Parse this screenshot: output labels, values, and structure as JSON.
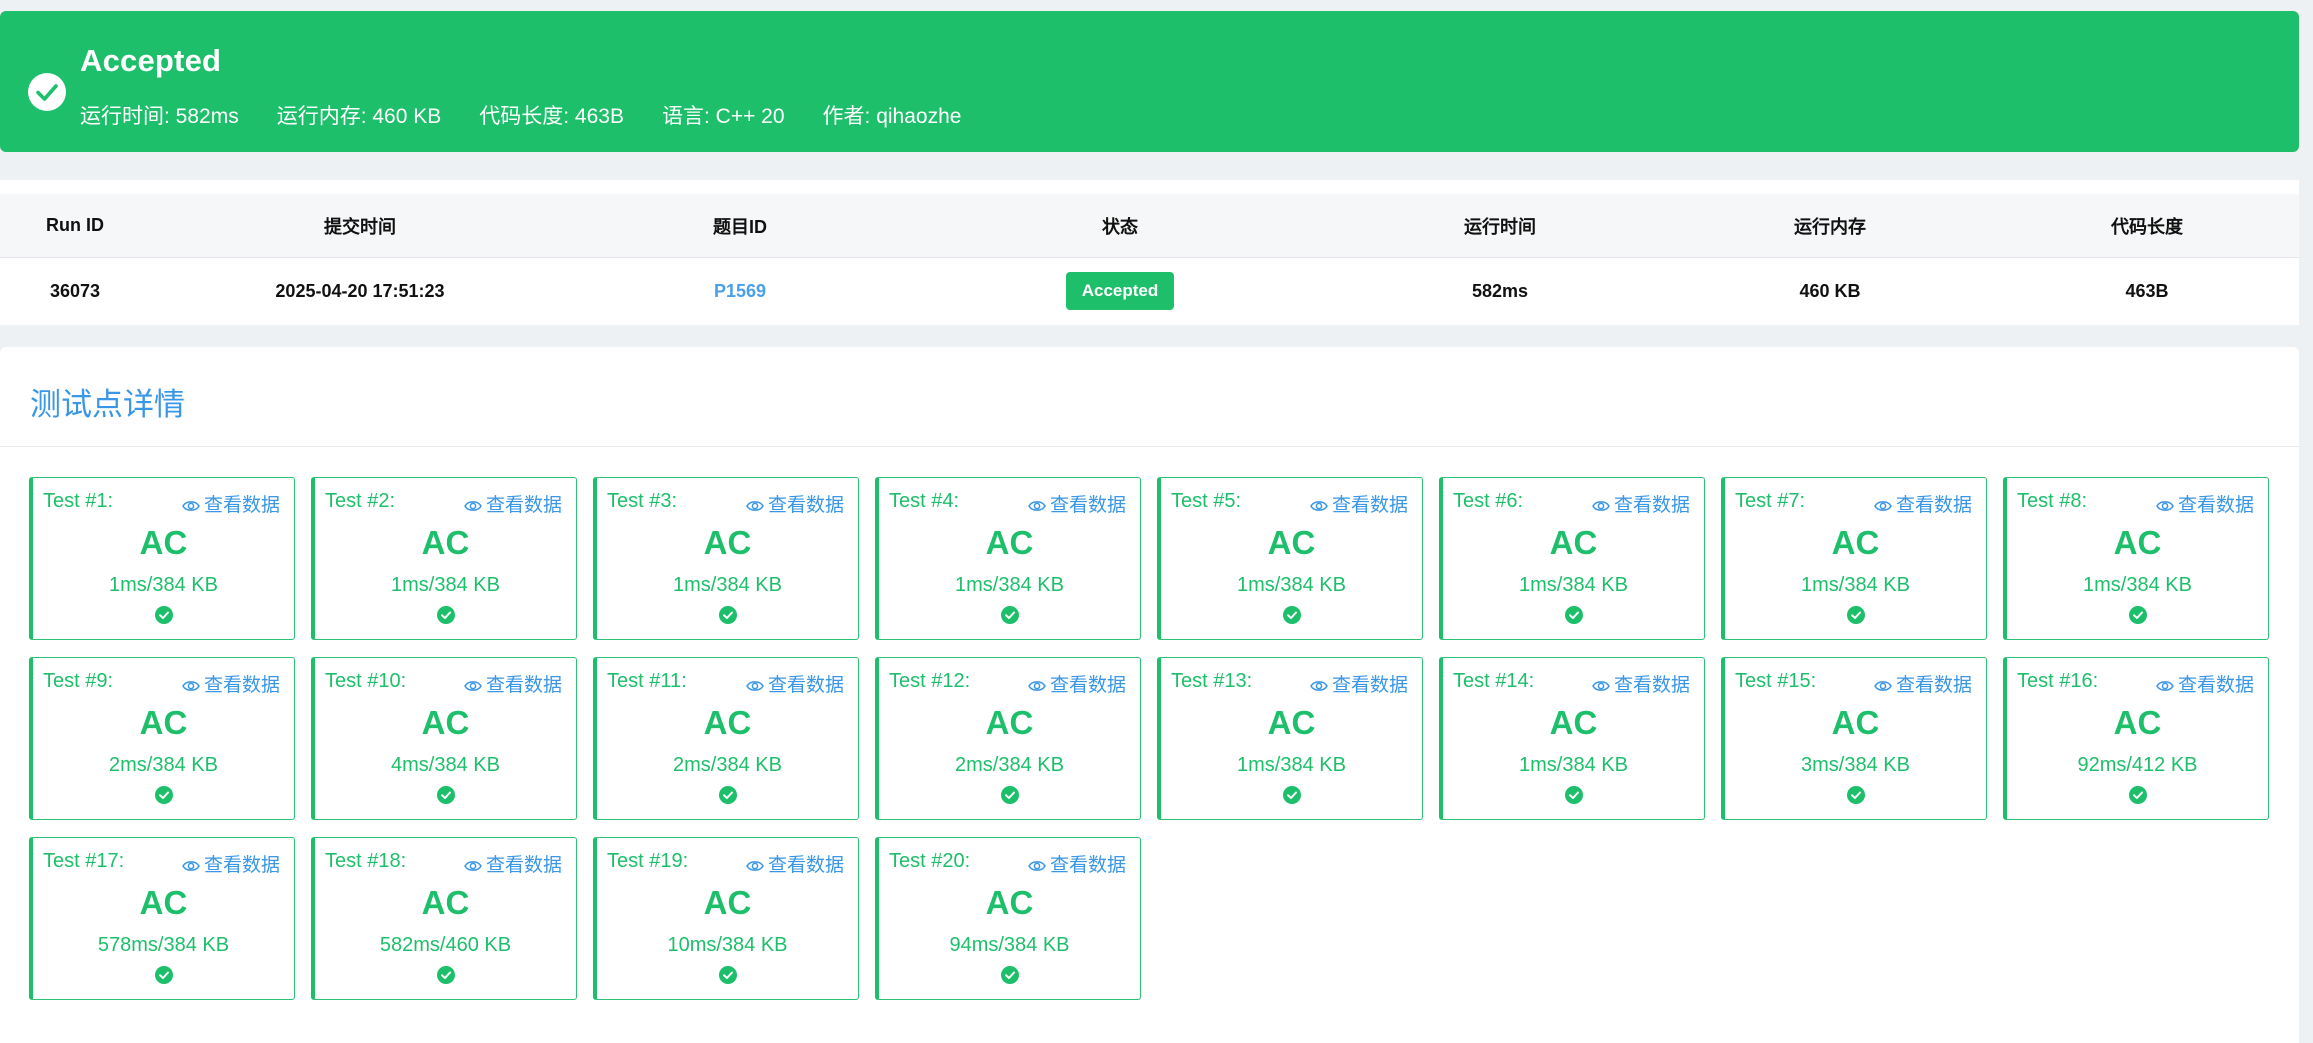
{
  "banner": {
    "status": "Accepted",
    "runtime": "运行时间: 582ms",
    "memory": "运行内存: 460 KB",
    "code_length": "代码长度: 463B",
    "language": "语言: C++ 20",
    "author": "作者: qihaozhe",
    "icon": "check-circle-icon",
    "color": "#1ebf6b"
  },
  "run_table": {
    "headers": [
      "Run ID",
      "提交时间",
      "题目ID",
      "状态",
      "运行时间",
      "运行内存",
      "代码长度"
    ],
    "row": {
      "run_id": "36073",
      "submit_time": "2025-04-20 17:51:23",
      "problem_id": "P1569",
      "status": "Accepted",
      "runtime": "582ms",
      "memory": "460 KB",
      "code_length": "463B"
    }
  },
  "tests_panel": {
    "title": "测试点详情",
    "view_label": "查看数据",
    "view_icon": "eye-icon",
    "tests": [
      {
        "name": "Test #1:",
        "verdict": "AC",
        "usage": "1ms/384 KB"
      },
      {
        "name": "Test #2:",
        "verdict": "AC",
        "usage": "1ms/384 KB"
      },
      {
        "name": "Test #3:",
        "verdict": "AC",
        "usage": "1ms/384 KB"
      },
      {
        "name": "Test #4:",
        "verdict": "AC",
        "usage": "1ms/384 KB"
      },
      {
        "name": "Test #5:",
        "verdict": "AC",
        "usage": "1ms/384 KB"
      },
      {
        "name": "Test #6:",
        "verdict": "AC",
        "usage": "1ms/384 KB"
      },
      {
        "name": "Test #7:",
        "verdict": "AC",
        "usage": "1ms/384 KB"
      },
      {
        "name": "Test #8:",
        "verdict": "AC",
        "usage": "1ms/384 KB"
      },
      {
        "name": "Test #9:",
        "verdict": "AC",
        "usage": "2ms/384 KB"
      },
      {
        "name": "Test #10:",
        "verdict": "AC",
        "usage": "4ms/384 KB"
      },
      {
        "name": "Test #11:",
        "verdict": "AC",
        "usage": "2ms/384 KB"
      },
      {
        "name": "Test #12:",
        "verdict": "AC",
        "usage": "2ms/384 KB"
      },
      {
        "name": "Test #13:",
        "verdict": "AC",
        "usage": "1ms/384 KB"
      },
      {
        "name": "Test #14:",
        "verdict": "AC",
        "usage": "1ms/384 KB"
      },
      {
        "name": "Test #15:",
        "verdict": "AC",
        "usage": "3ms/384 KB"
      },
      {
        "name": "Test #16:",
        "verdict": "AC",
        "usage": "92ms/412 KB"
      },
      {
        "name": "Test #17:",
        "verdict": "AC",
        "usage": "578ms/384 KB"
      },
      {
        "name": "Test #18:",
        "verdict": "AC",
        "usage": "582ms/460 KB"
      },
      {
        "name": "Test #19:",
        "verdict": "AC",
        "usage": "10ms/384 KB"
      },
      {
        "name": "Test #20:",
        "verdict": "AC",
        "usage": "94ms/384 KB"
      }
    ]
  }
}
